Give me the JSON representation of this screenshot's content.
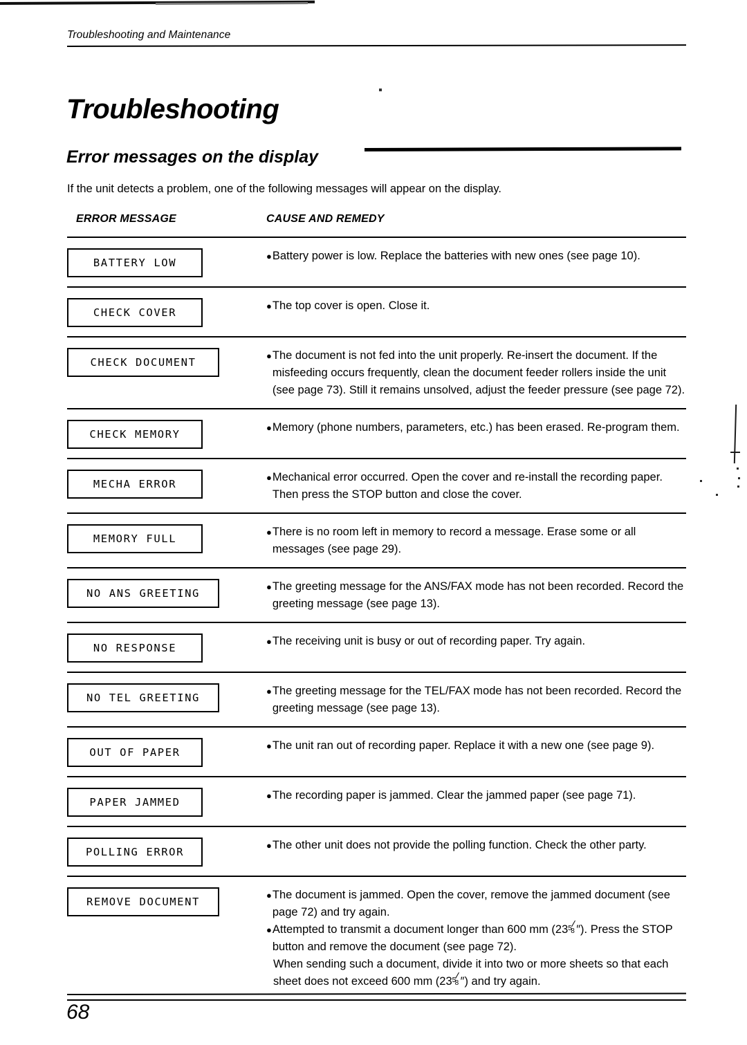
{
  "page": {
    "running_head": "Troubleshooting and Maintenance",
    "chapter_title": "Troubleshooting",
    "section_heading": "Error messages on the display",
    "intro": "If the unit detects a problem, one of the following messages will appear on the display.",
    "page_number": "68"
  },
  "table": {
    "headers": {
      "error_message": "ERROR MESSAGE",
      "cause_and_remedy": "CAUSE AND REMEDY"
    },
    "rows": [
      {
        "message": "BATTERY LOW",
        "bullets": [
          "Battery power is low. Replace the batteries with new ones (see page 10)."
        ]
      },
      {
        "message": "CHECK COVER",
        "bullets": [
          "The top cover is open. Close it."
        ]
      },
      {
        "message": "CHECK DOCUMENT",
        "bullets": [
          "The document is not fed into the unit properly. Re-insert the document. If the misfeeding occurs frequently, clean the document feeder rollers inside the unit (see page 73). Still it remains unsolved, adjust the feeder pressure (see page 72)."
        ]
      },
      {
        "message": "CHECK MEMORY",
        "bullets": [
          "Memory (phone numbers, parameters, etc.) has been erased. Re-program them."
        ]
      },
      {
        "message": "MECHA ERROR",
        "bullets": [
          "Mechanical error occurred. Open the cover and re-install the recording paper. Then press the STOP button and close the cover."
        ]
      },
      {
        "message": "MEMORY FULL",
        "bullets": [
          "There is no room left in memory to record a message. Erase some or all messages (see page 29)."
        ]
      },
      {
        "message": "NO ANS GREETING",
        "bullets": [
          "The greeting message for the ANS/FAX mode has not been recorded. Record the greeting message (see page 13)."
        ]
      },
      {
        "message": "NO RESPONSE",
        "bullets": [
          "The receiving unit is busy or out of recording paper. Try again."
        ]
      },
      {
        "message": "NO TEL GREETING",
        "bullets": [
          "The greeting message for the TEL/FAX mode has not been recorded. Record the greeting message (see page 13)."
        ]
      },
      {
        "message": "OUT OF PAPER",
        "bullets": [
          "The unit ran out of recording paper. Replace it with a new one (see page 9)."
        ]
      },
      {
        "message": "PAPER JAMMED",
        "bullets": [
          "The recording paper is jammed. Clear the jammed paper (see page 71)."
        ]
      },
      {
        "message": "POLLING ERROR",
        "bullets": [
          "The other unit does not provide the polling function. Check the other party."
        ]
      },
      {
        "message": "REMOVE DOCUMENT",
        "bullets": [
          "The document is jammed. Open the cover, remove the jammed document (see page 72) and try again."
        ],
        "bullet2_parts": {
          "a": "Attempted to transmit a document longer than 600 mm (23",
          "frac_num": "5",
          "frac_den": "8",
          "b": "″). Press the STOP button and remove the document (see page 72)."
        },
        "continuation_parts": {
          "a": "When sending such a document, divide it into two or more sheets so that each sheet does not exceed 600 mm (23",
          "frac_num": "5",
          "frac_den": "8",
          "b": "″) and try again."
        }
      }
    ]
  }
}
